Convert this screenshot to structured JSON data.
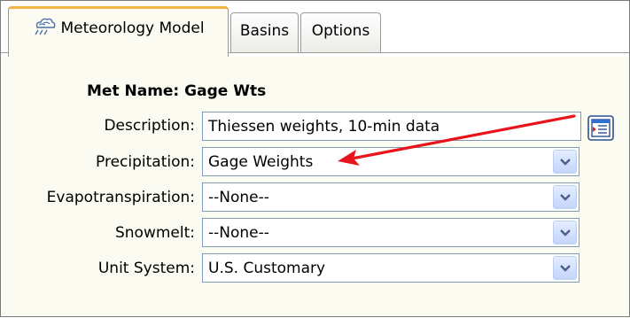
{
  "tabs": [
    {
      "label": "Meteorology Model",
      "icon": "meteorology-icon",
      "active": true
    },
    {
      "label": "Basins",
      "active": false
    },
    {
      "label": "Options",
      "active": false
    }
  ],
  "form": {
    "met_name_label": "Met Name:",
    "met_name_value": "Gage Wts",
    "description_label": "Description:",
    "description_value": "Thiessen weights, 10-min data",
    "precipitation_label": "Precipitation:",
    "precipitation_value": "Gage Weights",
    "evapotranspiration_label": "Evapotranspiration:",
    "evapotranspiration_value": "--None--",
    "snowmelt_label": "Snowmelt:",
    "snowmelt_value": "--None--",
    "unit_system_label": "Unit System:",
    "unit_system_value": "U.S. Customary"
  },
  "icons": {
    "dropdown": "chevron-down-icon",
    "description_editor": "edit-description-icon",
    "annotation": "red-arrow"
  },
  "colors": {
    "active_tab_accent": "#f3b34a",
    "annotation_arrow": "#e8141c",
    "dropdown_button": "#c3d5fb"
  }
}
